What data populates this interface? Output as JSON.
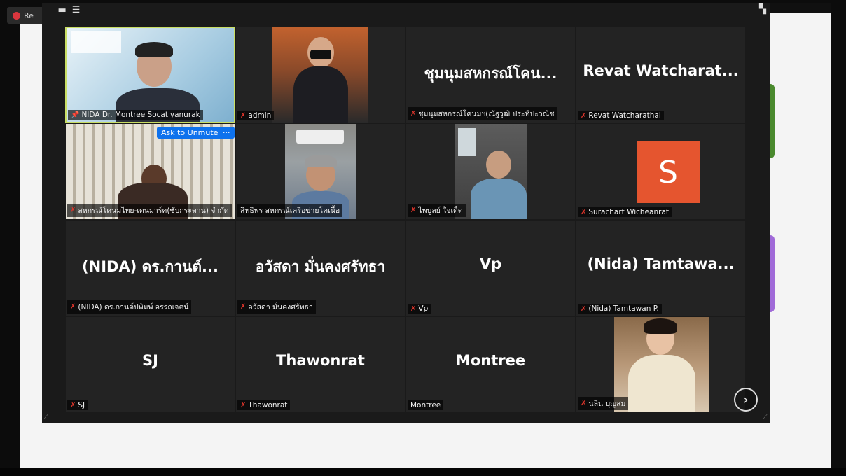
{
  "background_tab": {
    "label": "Re"
  },
  "toolbar": {
    "icons": [
      "minimize-icon",
      "speaker-view-icon",
      "menu-icon",
      "gallery-view-icon",
      "exit-fullscreen-icon"
    ]
  },
  "tiles": [
    {
      "label": "NIDA Dr. Montree Socatiyanurak",
      "pinned": true,
      "muted": false,
      "active": true,
      "video": true
    },
    {
      "label": "admin",
      "muted": true,
      "video": true
    },
    {
      "label": "ชุมนุมสหกรณ์โคนมฯ(ณัฐวุฒิ ประทีปะวณิช",
      "big_name": "ชุมนุมสหกรณ์โคน...",
      "muted": true,
      "video": false
    },
    {
      "label": "Revat Watcharathai",
      "big_name": "Revat Watcharat...",
      "muted": true,
      "video": false
    },
    {
      "label": "สหกรณ์โคนมไทย-เดนมาร์ค(ซับกระดาน) จำกัด",
      "muted": true,
      "video": true,
      "overlay_button": "Ask to Unmute",
      "more_button": "···"
    },
    {
      "label": "สิทธิพร สหกรณ์เครือข่ายโคเนื้อ",
      "muted": false,
      "video": true
    },
    {
      "label": "ไพบูลย์ ใจเด็ด",
      "muted": true,
      "video": true
    },
    {
      "label": "Surachart Wicheanrat",
      "avatar_letter": "S",
      "muted": true,
      "video": false
    },
    {
      "label": "(NIDA) ดร.กานต์ปพิมพ์ อรรถเจตน์",
      "big_name": "(NIDA) ดร.กานต์...",
      "muted": true,
      "video": false
    },
    {
      "label": "อวัสดา มั่นคงศรัทธา",
      "big_name": "อวัสดา มั่นคงศรัทธา",
      "muted": true,
      "video": false
    },
    {
      "label": "Vp",
      "big_name": "Vp",
      "muted": true,
      "video": false
    },
    {
      "label": "(Nida) Tamtawan P.",
      "big_name": "(Nida)  Tamtawa...",
      "muted": true,
      "video": false
    },
    {
      "label": "SJ",
      "big_name": "SJ",
      "muted": true,
      "video": false
    },
    {
      "label": "Thawonrat",
      "big_name": "Thawonrat",
      "muted": true,
      "video": false
    },
    {
      "label": "Montree",
      "big_name": "Montree",
      "muted": false,
      "video": false
    },
    {
      "label": "นลิน บุญสม",
      "muted": true,
      "video": true
    }
  ],
  "next_page_icon": "chevron-right-icon",
  "colors": {
    "avatar": "#e5552f",
    "unmute_button": "#0e72ed",
    "active_speaker_border": "#c9de64",
    "muted_mic": "#e0352b"
  }
}
